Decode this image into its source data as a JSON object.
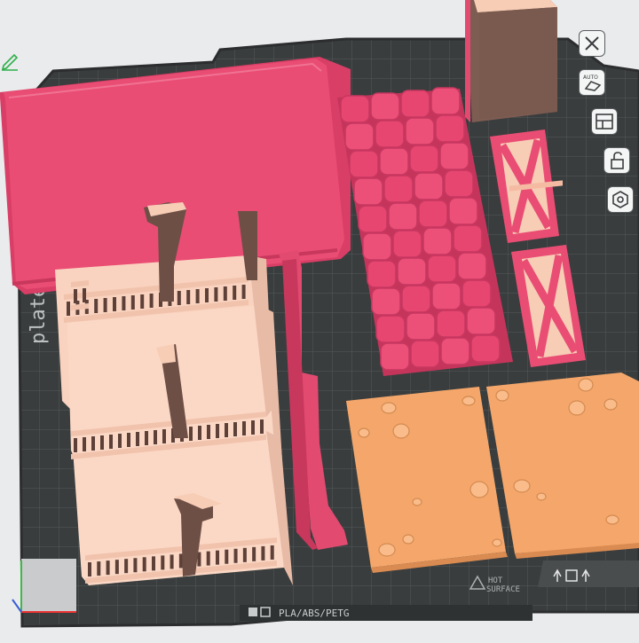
{
  "plate": {
    "name_fragment": "plate",
    "filament_label": "PLA/ABS/PETG",
    "hot_surface_label": "HOT\nSURFACE"
  },
  "toolbar": {
    "items": [
      {
        "name": "close",
        "icon": "close-icon"
      },
      {
        "name": "auto-orient",
        "icon": "auto-orient-icon",
        "text": "AUTO"
      },
      {
        "name": "arrange",
        "icon": "arrange-icon"
      },
      {
        "name": "lock",
        "icon": "unlock-icon"
      },
      {
        "name": "settings",
        "icon": "hexagon-nut-icon"
      }
    ]
  },
  "colors": {
    "pink": "#ea4d74",
    "peach": "#fbd2bd",
    "orange": "#f5a76b",
    "brown": "#7d5c52",
    "bed": "#3c3f40",
    "grid": "#55595a"
  }
}
